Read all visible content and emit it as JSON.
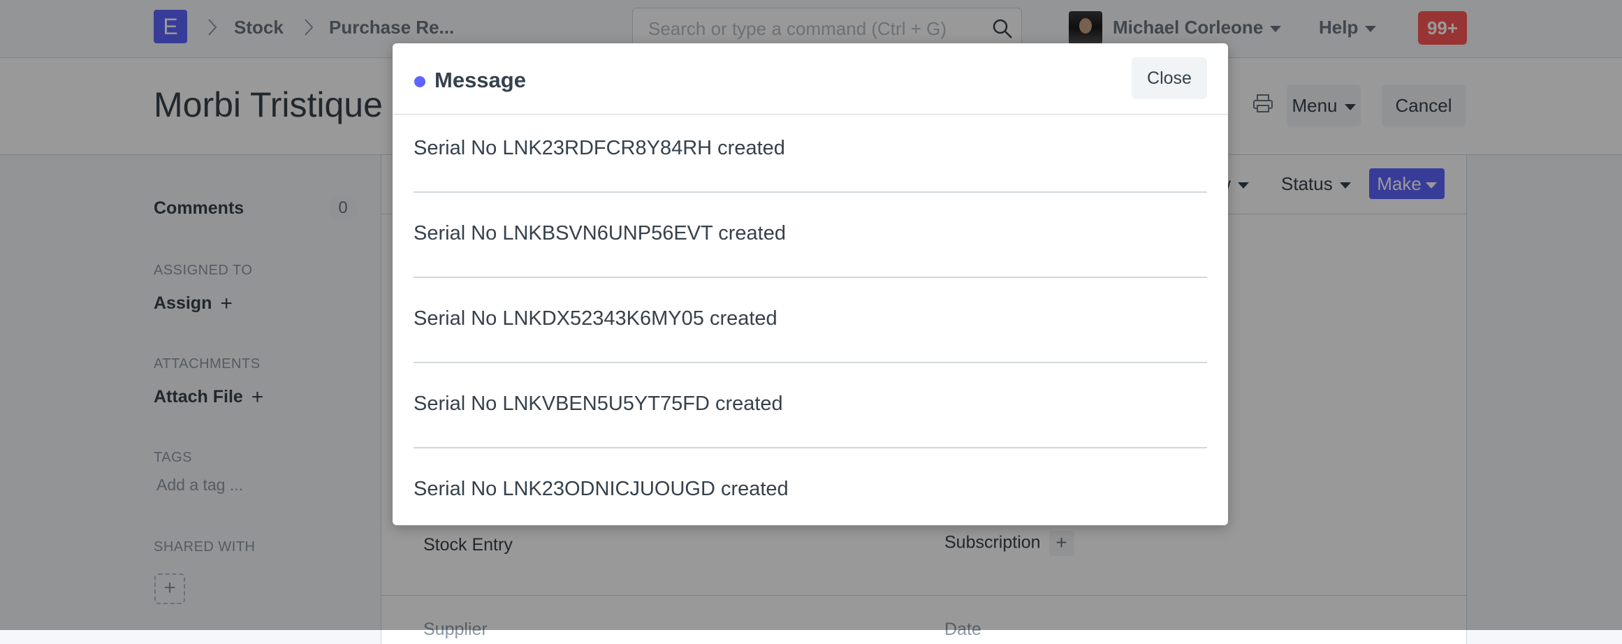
{
  "navbar": {
    "logo_letter": "E",
    "breadcrumbs": [
      "Stock",
      "Purchase Re..."
    ],
    "search_placeholder": "Search or type a command (Ctrl + G)",
    "user_name": "Michael Corleone",
    "help_label": "Help",
    "notification_count": "99+"
  },
  "page_head": {
    "title": "Morbi Tristique F",
    "menu_label": "Menu",
    "cancel_label": "Cancel"
  },
  "sidebar": {
    "comments_label": "Comments",
    "comments_count": "0",
    "assigned_heading": "ASSIGNED TO",
    "assign_label": "Assign",
    "attachments_heading": "ATTACHMENTS",
    "attach_label": "Attach File",
    "tags_heading": "TAGS",
    "add_tag_placeholder": "Add a tag ...",
    "shared_heading": "SHARED WITH"
  },
  "form": {
    "toolbar": {
      "view_fragment": "w",
      "status_label": "Status",
      "make_label": "Make"
    },
    "links": {
      "stock_entry": "Stock Entry",
      "subscription": "Subscription"
    },
    "fields": {
      "supplier": "Supplier",
      "date": "Date"
    }
  },
  "modal": {
    "title": "Message",
    "close_label": "Close",
    "messages": [
      "Serial No LNK23RDFCR8Y84RH created",
      "Serial No LNKBSVN6UNP56EVT created",
      "Serial No LNKDX52343K6MY05 created",
      "Serial No LNKVBEN5U5YT75FD created",
      "Serial No LNK23ODNICJUOUGD created"
    ]
  },
  "colors": {
    "primary": "#5e64ff",
    "badge": "#ff5858",
    "text": "#36414c",
    "muted": "#8d99a6"
  },
  "icons": [
    "chevron-right-icon",
    "search-icon",
    "caret-down-icon",
    "print-icon",
    "plus-icon"
  ]
}
